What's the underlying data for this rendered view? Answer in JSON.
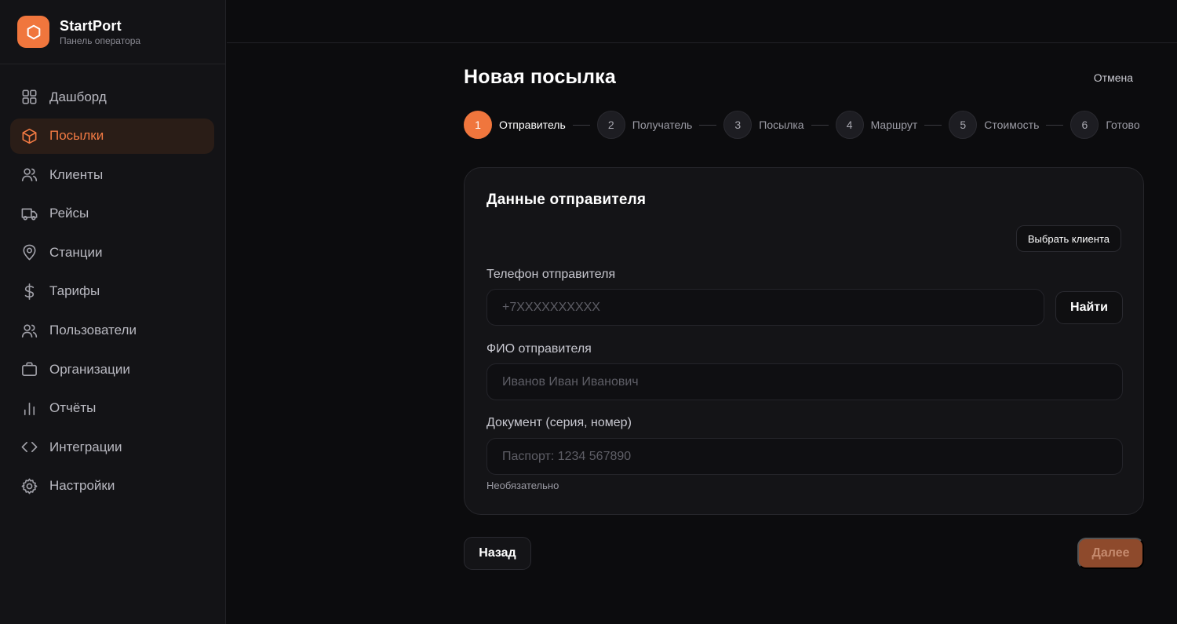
{
  "brand": {
    "name": "StartPort",
    "subtitle": "Панель оператора",
    "accent": "#f0763d"
  },
  "sidebar": {
    "items": [
      {
        "label": "Дашборд",
        "icon": "dashboard-icon",
        "active": false
      },
      {
        "label": "Посылки",
        "icon": "box-icon",
        "active": true
      },
      {
        "label": "Клиенты",
        "icon": "users-icon",
        "active": false
      },
      {
        "label": "Рейсы",
        "icon": "truck-icon",
        "active": false
      },
      {
        "label": "Станции",
        "icon": "map-pin-icon",
        "active": false
      },
      {
        "label": "Тарифы",
        "icon": "dollar-icon",
        "active": false
      },
      {
        "label": "Пользователи",
        "icon": "users-icon",
        "active": false
      },
      {
        "label": "Организации",
        "icon": "briefcase-icon",
        "active": false
      },
      {
        "label": "Отчёты",
        "icon": "bar-chart-icon",
        "active": false
      },
      {
        "label": "Интеграции",
        "icon": "code-icon",
        "active": false
      },
      {
        "label": "Настройки",
        "icon": "gear-icon",
        "active": false
      }
    ]
  },
  "page": {
    "title": "Новая посылка",
    "cancel_label": "Отмена"
  },
  "stepper": {
    "steps": [
      {
        "num": "1",
        "label": "Отправитель",
        "active": true
      },
      {
        "num": "2",
        "label": "Получатель",
        "active": false
      },
      {
        "num": "3",
        "label": "Посылка",
        "active": false
      },
      {
        "num": "4",
        "label": "Маршрут",
        "active": false
      },
      {
        "num": "5",
        "label": "Стоимость",
        "active": false
      },
      {
        "num": "6",
        "label": "Готово",
        "active": false
      }
    ]
  },
  "form": {
    "title": "Данные отправителя",
    "pick_client_label": "Выбрать клиента",
    "phone": {
      "label": "Телефон отправителя",
      "placeholder": "+7XXXXXXXXXX",
      "value": ""
    },
    "find_label": "Найти",
    "fio": {
      "label": "ФИО отправителя",
      "placeholder": "Иванов Иван Иванович",
      "value": ""
    },
    "document": {
      "label": "Документ (серия, номер)",
      "placeholder": "Паспорт: 1234 567890",
      "value": "",
      "hint": "Необязательно"
    }
  },
  "actions": {
    "back_label": "Назад",
    "next_label": "Далее"
  }
}
